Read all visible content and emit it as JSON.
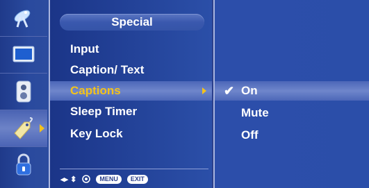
{
  "left_icons": [
    {
      "name": "satellite-icon"
    },
    {
      "name": "picture-icon"
    },
    {
      "name": "audio-icon"
    },
    {
      "name": "special-tag-icon",
      "selected": true
    },
    {
      "name": "lock-icon"
    }
  ],
  "menu": {
    "title": "Special",
    "items": [
      {
        "label": "Input"
      },
      {
        "label": "Caption/ Text"
      },
      {
        "label": "Captions",
        "selected": true
      },
      {
        "label": "Sleep Timer"
      },
      {
        "label": "Key Lock"
      }
    ],
    "nav_hints": {
      "arrows": "◂▸ ⬍",
      "ok_icon": "ok-circle-icon",
      "menu_label": "MENU",
      "exit_label": "EXIT"
    }
  },
  "submenu": {
    "items": [
      {
        "label": "On",
        "checked": true,
        "selected": true
      },
      {
        "label": "Mute"
      },
      {
        "label": "Off"
      }
    ],
    "check_glyph": "✔"
  },
  "colors": {
    "highlight_text": "#f3c21b",
    "background": "#2a3f8c"
  }
}
